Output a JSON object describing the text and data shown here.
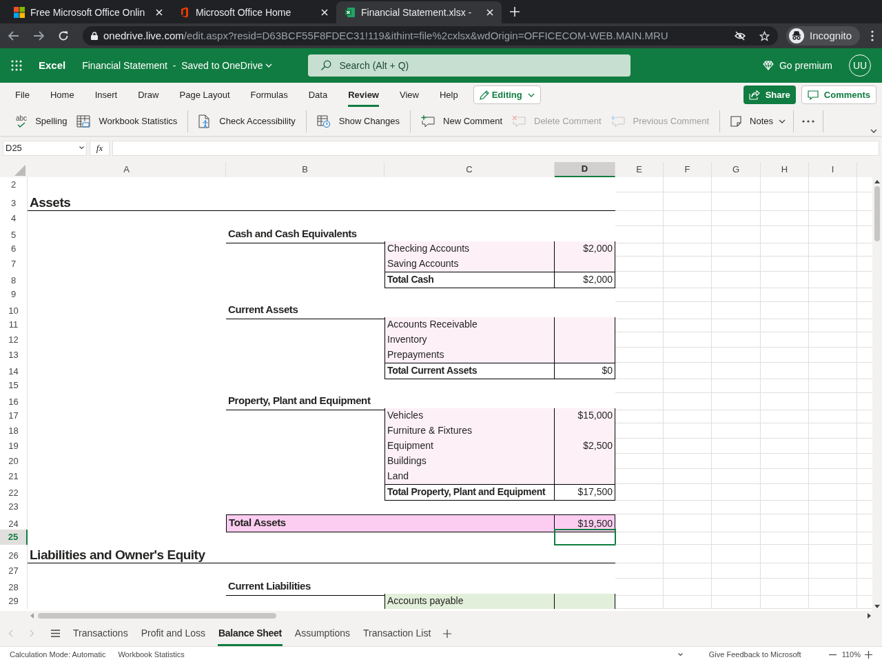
{
  "browser": {
    "tabs": [
      {
        "title": "Free Microsoft Office Onlin",
        "kind": "windows",
        "selected": false
      },
      {
        "title": "Microsoft Office Home",
        "kind": "office",
        "selected": false
      },
      {
        "title": "Financial Statement.xlsx -",
        "kind": "excel",
        "selected": true
      }
    ],
    "url_host": "onedrive.live.com",
    "url_path": "/edit.aspx?resid=D63BCF55F8FDEC31!119&ithint=file%2cxlsx&wdOrigin=OFFICECOM-WEB.MAIN.MRU",
    "profile": "Incognito"
  },
  "app": {
    "name": "Excel",
    "document": "Financial Statement",
    "separator": "-",
    "save_status": "Saved to OneDrive",
    "search_placeholder": "Search (Alt + Q)",
    "premium": "Go premium",
    "avatar": "UU"
  },
  "ribbon_tabs": [
    {
      "label": "File",
      "selected": false
    },
    {
      "label": "Home",
      "selected": false
    },
    {
      "label": "Insert",
      "selected": false
    },
    {
      "label": "Draw",
      "selected": false
    },
    {
      "label": "Page Layout",
      "selected": false
    },
    {
      "label": "Formulas",
      "selected": false
    },
    {
      "label": "Data",
      "selected": false
    },
    {
      "label": "Review",
      "selected": true
    },
    {
      "label": "View",
      "selected": false
    },
    {
      "label": "Help",
      "selected": false
    }
  ],
  "mode_button": "Editing",
  "share_button": "Share",
  "comments_button": "Comments",
  "command_groups": [
    [
      {
        "label": "Spelling",
        "kind": "spelling",
        "icon_text": "abc",
        "disabled": false
      },
      {
        "label": "Workbook Statistics",
        "kind": "stats",
        "disabled": false
      }
    ],
    [
      {
        "label": "Check Accessibility",
        "kind": "accessibility",
        "disabled": false
      }
    ],
    [
      {
        "label": "Show Changes",
        "kind": "changes",
        "disabled": false
      }
    ],
    [
      {
        "label": "New Comment",
        "kind": "new-comment",
        "disabled": false
      },
      {
        "label": "Delete Comment",
        "kind": "delete-comment",
        "disabled": true
      },
      {
        "label": "Previous Comment",
        "kind": "previous-comment",
        "disabled": true
      }
    ],
    [
      {
        "label": "Notes",
        "kind": "note",
        "disabled": false,
        "dropdown": true
      }
    ]
  ],
  "formula_bar": {
    "name_box": "D25",
    "function_label": "fx"
  },
  "columns": [
    {
      "label": "A",
      "selected": false
    },
    {
      "label": "B",
      "selected": false
    },
    {
      "label": "C",
      "selected": false
    },
    {
      "label": "D",
      "selected": true
    },
    {
      "label": "E",
      "selected": false
    },
    {
      "label": "F",
      "selected": false
    },
    {
      "label": "G",
      "selected": false
    },
    {
      "label": "H",
      "selected": false
    },
    {
      "label": "I",
      "selected": false
    }
  ],
  "rows": [
    {
      "number": "2",
      "kind": "blank",
      "selected": false
    },
    {
      "number": "3",
      "kind": "title",
      "selected": false,
      "a": "Assets"
    },
    {
      "number": "4",
      "kind": "blank",
      "selected": false
    },
    {
      "number": "5",
      "kind": "section",
      "selected": false,
      "b": "Cash and Cash Equivalents"
    },
    {
      "number": "6",
      "kind": "item",
      "color": "#fdf1f7",
      "selected": false,
      "c": "Checking Accounts",
      "d": "$2,000"
    },
    {
      "number": "7",
      "kind": "item",
      "color": "#fdf1f7",
      "selected": false,
      "c": "Saving Accounts"
    },
    {
      "number": "8",
      "kind": "total",
      "selected": false,
      "c": "Total Cash",
      "d": "$2,000"
    },
    {
      "number": "9",
      "kind": "blank",
      "selected": false
    },
    {
      "number": "10",
      "kind": "section",
      "selected": false,
      "b": "Current Assets"
    },
    {
      "number": "11",
      "kind": "item",
      "color": "#fdf1f7",
      "selected": false,
      "c": "Accounts Receivable"
    },
    {
      "number": "12",
      "kind": "item",
      "color": "#fdf1f7",
      "selected": false,
      "c": "Inventory"
    },
    {
      "number": "13",
      "kind": "item",
      "color": "#fdf1f7",
      "selected": false,
      "c": "Prepayments"
    },
    {
      "number": "14",
      "kind": "total",
      "selected": false,
      "c": "Total Current Assets",
      "d": "$0"
    },
    {
      "number": "15",
      "kind": "blank",
      "selected": false
    },
    {
      "number": "16",
      "kind": "section",
      "selected": false,
      "b": "Property, Plant and Equipment"
    },
    {
      "number": "17",
      "kind": "item",
      "color": "#fdf1f7",
      "selected": false,
      "c": "Vehicles",
      "d": "$15,000"
    },
    {
      "number": "18",
      "kind": "item",
      "color": "#fdf1f7",
      "selected": false,
      "c": "Furniture & Fixtures"
    },
    {
      "number": "19",
      "kind": "item",
      "color": "#fdf1f7",
      "selected": false,
      "c": "Equipment",
      "d": "$2,500"
    },
    {
      "number": "20",
      "kind": "item",
      "color": "#fdf1f7",
      "selected": false,
      "c": "Buildings"
    },
    {
      "number": "21",
      "kind": "item",
      "color": "#fdf1f7",
      "selected": false,
      "c": "Land"
    },
    {
      "number": "22",
      "kind": "total",
      "selected": false,
      "c": "Total Property, Plant and Equipment",
      "d": "$17,500"
    },
    {
      "number": "23",
      "kind": "blank",
      "selected": false
    },
    {
      "number": "24",
      "kind": "grand-total",
      "color": "#fccdf0",
      "selected": false,
      "b": "Total Assets",
      "d": "$19,500"
    },
    {
      "number": "25",
      "kind": "blank",
      "selected": true
    },
    {
      "number": "26",
      "kind": "title",
      "selected": false,
      "a": "Liabilities and Owner's Equity"
    },
    {
      "number": "27",
      "kind": "blank",
      "selected": false
    },
    {
      "number": "28",
      "kind": "section",
      "selected": false,
      "b": "Current Liabilities"
    },
    {
      "number": "29",
      "kind": "item",
      "color": "#e2efda",
      "selected": false,
      "c": "Accounts payable"
    }
  ],
  "sheet_tabs": [
    {
      "label": "Transactions",
      "selected": false
    },
    {
      "label": "Profit and Loss",
      "selected": false
    },
    {
      "label": "Balance Sheet",
      "selected": true
    },
    {
      "label": "Assumptions",
      "selected": false
    },
    {
      "label": "Transaction List",
      "selected": false
    }
  ],
  "status_bar": {
    "items": [
      "Calculation Mode: Automatic",
      "Workbook Statistics"
    ],
    "feedback": "Give Feedback to Microsoft",
    "zoom": "110%"
  }
}
